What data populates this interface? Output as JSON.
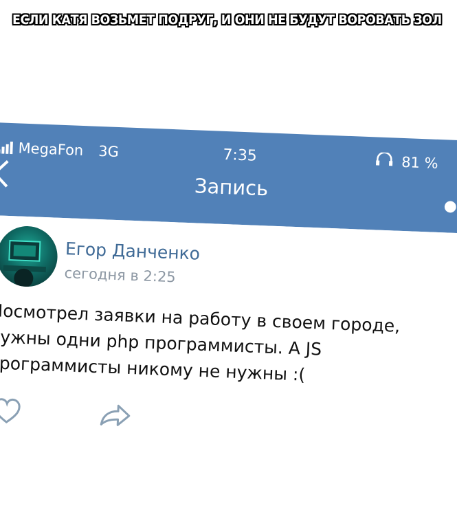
{
  "caption": "ЕСЛИ КАТЯ ВОЗЬМЕТ ПОДРУГ, И ОНИ НЕ БУДУТ ВОРОВАТЬ ЗОЛ",
  "status_bar": {
    "carrier": "MegaFon",
    "network": "3G",
    "time": "7:35",
    "battery": "81 %"
  },
  "nav": {
    "back_icon": "chevron-left-icon",
    "title": "Запись",
    "menu_icon": "more-icon"
  },
  "post": {
    "author": "Егор Данченко",
    "time": "сегодня в 2:25",
    "lines": [
      "Посмотрел заявки на работу в своем городе,",
      "нужны одни php программисты. А JS",
      "программисты никому не нужны :("
    ]
  },
  "actions": {
    "like_icon": "heart-icon",
    "share_icon": "share-icon"
  },
  "colors": {
    "header": "#5181b8",
    "author": "#3f6a96",
    "muted": "#8c97a3",
    "icon": "#8aa0b4"
  }
}
